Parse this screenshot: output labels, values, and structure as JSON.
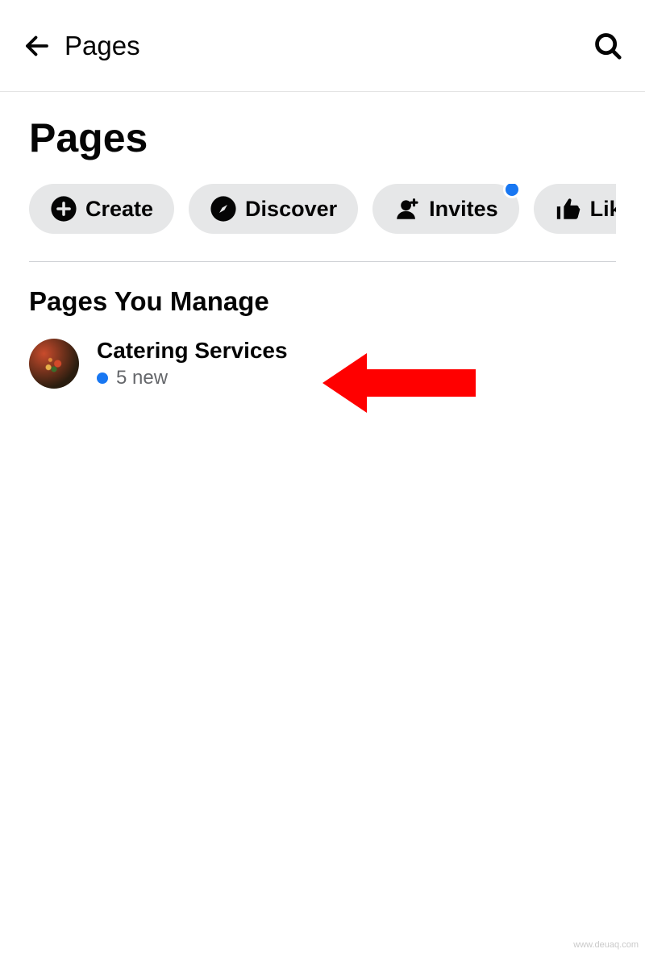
{
  "header": {
    "title": "Pages"
  },
  "main": {
    "heading": "Pages",
    "chips": [
      {
        "label": "Create",
        "icon": "plus-circle-icon",
        "badge": false
      },
      {
        "label": "Discover",
        "icon": "compass-icon",
        "badge": false
      },
      {
        "label": "Invites",
        "icon": "person-plus-icon",
        "badge": true
      },
      {
        "label": "Liked",
        "icon": "thumb-up-icon",
        "badge": false
      }
    ],
    "section_heading": "Pages You Manage",
    "pages": [
      {
        "title": "Catering Services",
        "status_text": "5 new",
        "has_status_dot": true
      }
    ]
  },
  "watermark": "www.deuaq.com",
  "colors": {
    "accent": "#1877f2",
    "chip_bg": "#e6e7e8",
    "text": "#050505",
    "secondary_text": "#65676b",
    "arrow": "#ff0000"
  }
}
